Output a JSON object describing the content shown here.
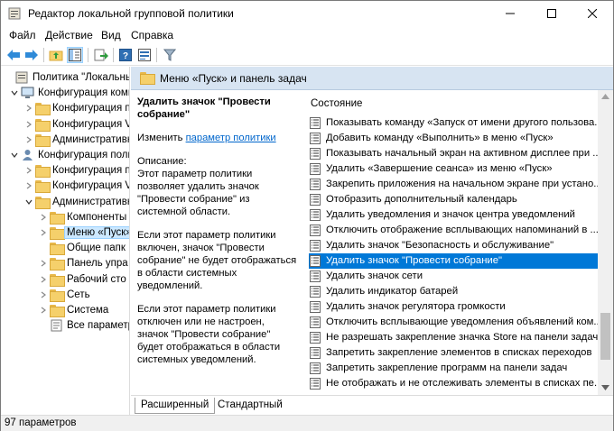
{
  "window": {
    "title": "Редактор локальной групповой политики"
  },
  "menu": [
    "Файл",
    "Действие",
    "Вид",
    "Справка"
  ],
  "toolbar": {
    "icons": [
      "back-icon",
      "forward-icon",
      "up-folder-icon",
      "show-hide-tree-icon",
      "export-icon",
      "help-icon",
      "properties-icon",
      "filter-icon"
    ]
  },
  "tree": {
    "items": [
      {
        "label": "Политика \"Локальный",
        "level": 0,
        "expander": "",
        "icon": "policy"
      },
      {
        "label": "Конфигурация комп",
        "level": 1,
        "expander": "expanded",
        "icon": "computer"
      },
      {
        "label": "Конфигурация п",
        "level": 2,
        "expander": "collapsed",
        "icon": "folder"
      },
      {
        "label": "Конфигурация V",
        "level": 2,
        "expander": "collapsed",
        "icon": "folder"
      },
      {
        "label": "Административн",
        "level": 2,
        "expander": "collapsed",
        "icon": "folder"
      },
      {
        "label": "Конфигурация поль",
        "level": 1,
        "expander": "expanded",
        "icon": "user"
      },
      {
        "label": "Конфигурация п",
        "level": 2,
        "expander": "collapsed",
        "icon": "folder"
      },
      {
        "label": "Конфигурация V",
        "level": 2,
        "expander": "collapsed",
        "icon": "folder"
      },
      {
        "label": "Административн",
        "level": 2,
        "expander": "expanded",
        "icon": "folder"
      },
      {
        "label": "Компоненты",
        "level": 3,
        "expander": "collapsed",
        "icon": "folder"
      },
      {
        "label": "Меню «Пуск»",
        "level": 3,
        "expander": "collapsed",
        "icon": "folder",
        "selected": true
      },
      {
        "label": "Общие папк",
        "level": 3,
        "expander": "",
        "icon": "folder"
      },
      {
        "label": "Панель упра",
        "level": 3,
        "expander": "collapsed",
        "icon": "folder"
      },
      {
        "label": "Рабочий сто",
        "level": 3,
        "expander": "collapsed",
        "icon": "folder"
      },
      {
        "label": "Сеть",
        "level": 3,
        "expander": "collapsed",
        "icon": "folder"
      },
      {
        "label": "Система",
        "level": 3,
        "expander": "collapsed",
        "icon": "folder"
      },
      {
        "label": "Все параметр",
        "level": 3,
        "expander": "",
        "icon": "settings"
      }
    ]
  },
  "content": {
    "header_title": "Меню «Пуск» и панель задач",
    "description": {
      "heading": "Удалить значок \"Провести собрание\"",
      "edit_prefix": "Изменить ",
      "edit_link": "параметр политики",
      "p1": "Описание:\nЭтот параметр политики позволяет удалить значок \"Провести собрание\" из системной области.",
      "p2": "Если этот параметр политики включен, значок \"Провести собрание\" не будет отображаться в области системных уведомлений.",
      "p3": "Если этот параметр политики отключен или не настроен, значок \"Провести собрание\" будет отображаться в области системных уведомлений."
    },
    "list_header": "Состояние",
    "list_items": [
      "Показывать команду «Запуск от имени другого пользова...",
      "Добавить команду «Выполнить» в меню «Пуск»",
      "Показывать начальный экран на активном дисплее при ...",
      "Удалить «Завершение сеанса» из меню «Пуск»",
      "Закрепить приложения на начальном экране при устано...",
      "Отобразить дополнительный календарь",
      "Удалить уведомления и значок центра уведомлений",
      "Отключить отображение всплывающих напоминаний в ...",
      "Удалить значок \"Безопасность и обслуживание\"",
      "Удалить значок \"Провести собрание\"",
      "Удалить значок сети",
      "Удалить индикатор батарей",
      "Удалить значок регулятора громкости",
      "Отключить всплывающие уведомления объявлений ком...",
      "Не разрешать закрепление значка Store на панели задач",
      "Запретить закрепление элементов в списках переходов",
      "Запретить закрепление программ на панели задач",
      "Не отображать и не отслеживать элементы в списках пе..."
    ],
    "selected_index": 9,
    "tabs": [
      "Расширенный",
      "Стандартный"
    ]
  },
  "status": {
    "text": "97 параметров"
  },
  "colors": {
    "header_bg": "#d7e4f2",
    "selection": "#0078d7",
    "link": "#0066cc"
  }
}
